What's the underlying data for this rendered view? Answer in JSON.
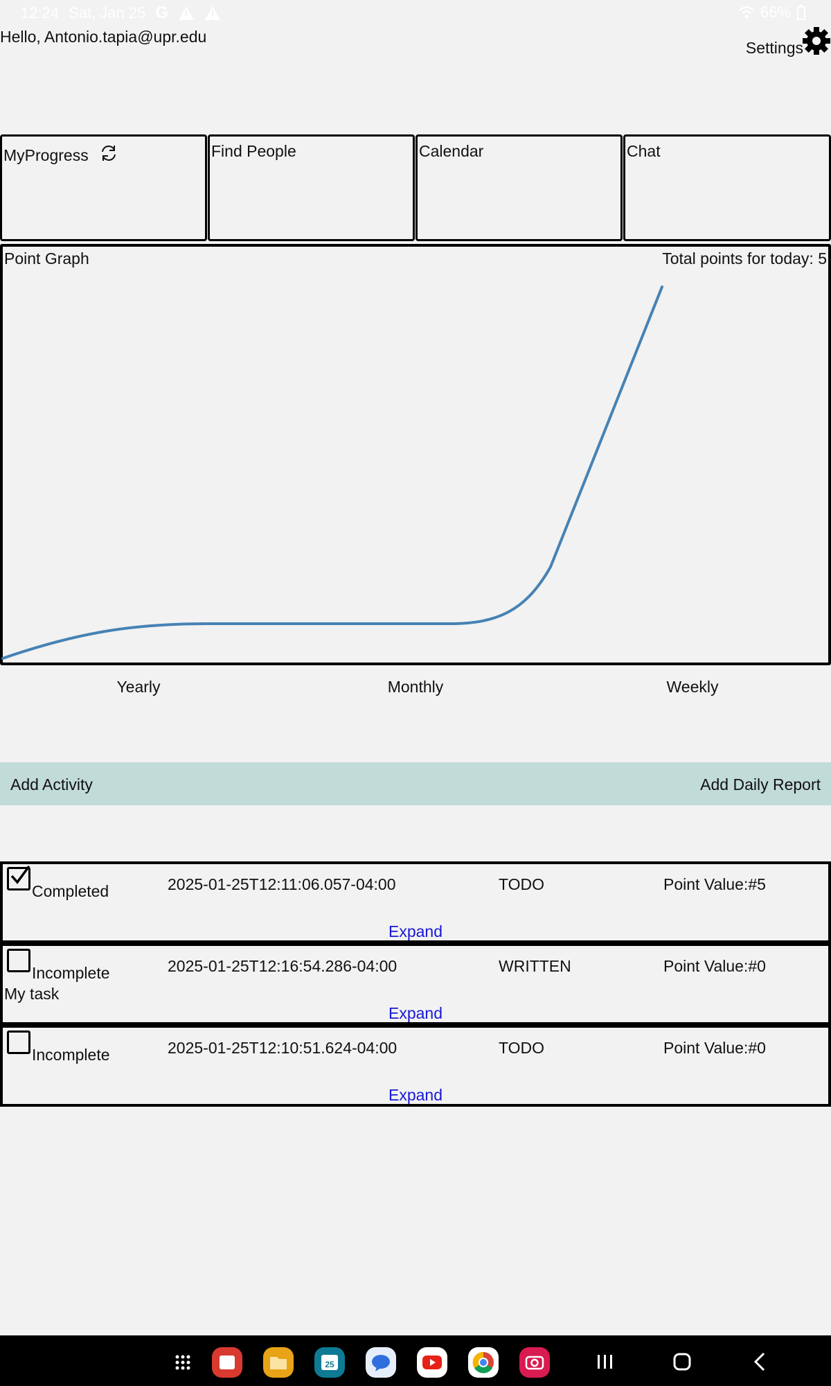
{
  "status_bar": {
    "time": "12:24",
    "date": "Sat, Jan 25",
    "battery": "66%"
  },
  "header": {
    "greeting": "Hello, Antonio.tapia@upr.edu",
    "settings_label": "Settings"
  },
  "tiles": {
    "my_progress": "MyProgress",
    "find_people": "Find People",
    "calendar": "Calendar",
    "chat": "Chat"
  },
  "graph": {
    "title": "Point Graph",
    "total": "Total points for today: 5"
  },
  "chart_data": {
    "type": "line",
    "title": "Point Graph",
    "categories": [
      "Yearly",
      "Monthly",
      "Weekly"
    ],
    "series": [
      {
        "values": [
          0,
          0,
          5
        ]
      }
    ],
    "ylim": [
      0,
      5
    ],
    "line_color": "#4682b4",
    "grid": false,
    "legend": "none"
  },
  "actions": {
    "add_activity": "Add Activity",
    "add_daily_report": "Add Daily Report",
    "bar_color": "#c1dbd9"
  },
  "activities": [
    {
      "checked": true,
      "status": "Completed",
      "date": "2025-01-25T12:11:06.057-04:00",
      "type": "TODO",
      "points": "Point Value:#5",
      "description": "",
      "expand": "Expand"
    },
    {
      "checked": false,
      "status": "Incomplete",
      "date": "2025-01-25T12:16:54.286-04:00",
      "type": "WRITTEN",
      "points": "Point Value:#0",
      "description": "My task",
      "expand": "Expand"
    },
    {
      "checked": false,
      "status": "Incomplete",
      "date": "2025-01-25T12:10:51.624-04:00",
      "type": "TODO",
      "points": "Point Value:#0",
      "description": "",
      "expand": "Expand"
    }
  ],
  "dock_apps": [
    "apps-grid-icon",
    "notes-app-icon",
    "files-app-icon",
    "calendar-app-icon",
    "messages-app-icon",
    "youtube-app-icon",
    "chrome-app-icon",
    "camera-app-icon"
  ],
  "calendar_app_day": "25"
}
